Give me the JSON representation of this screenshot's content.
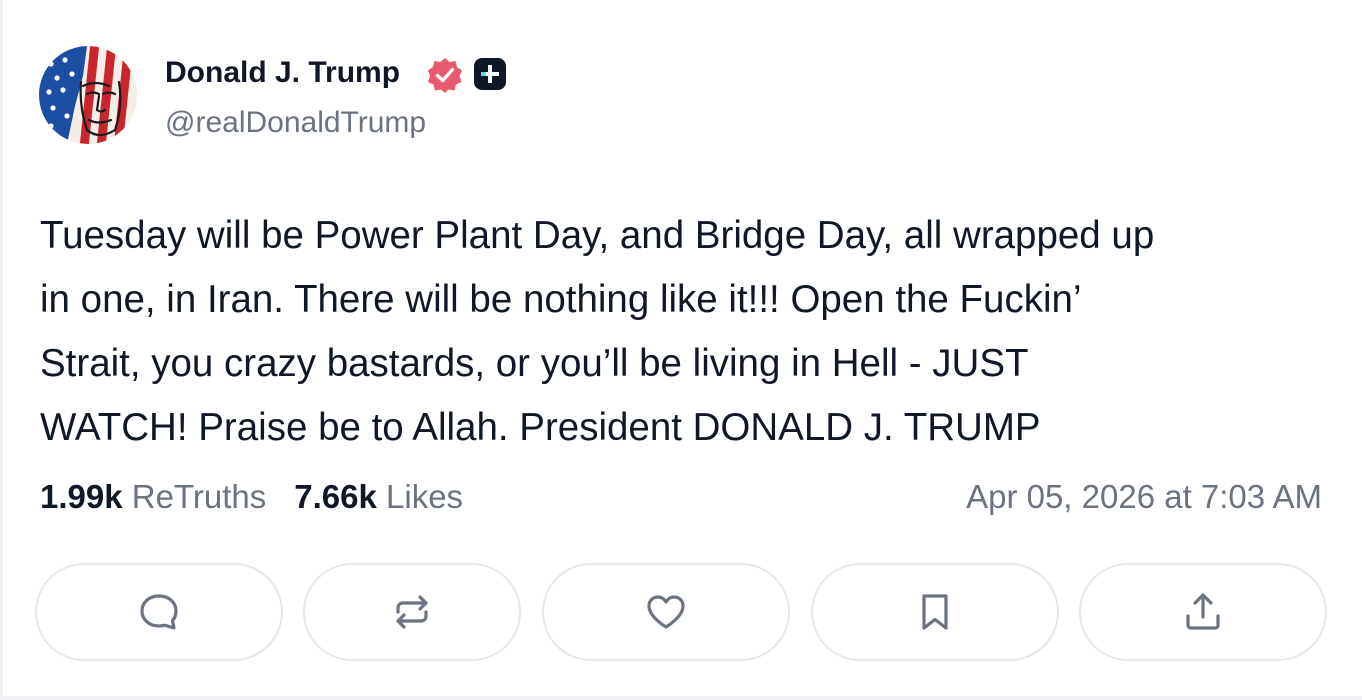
{
  "post": {
    "author": {
      "display_name": "Donald J. Trump",
      "handle": "@realDonaldTrump",
      "avatar_icon": "flag-portrait-avatar",
      "verified_icon": "verified-badge-icon",
      "verified_color": "#ea5a6e",
      "plus_icon": "plus-badge-icon"
    },
    "body_lines": [
      "Tuesday will be Power Plant Day, and Bridge Day, all wrapped up",
      "in one, in Iran. There will be nothing like it!!! Open the Fuckin’",
      "Strait, you crazy bastards, or you’ll be living in Hell - JUST",
      "WATCH! Praise be to Allah. President DONALD J. TRUMP"
    ],
    "stats": {
      "retruths_count": "1.99k",
      "retruths_label": "ReTruths",
      "likes_count": "7.66k",
      "likes_label": "Likes"
    },
    "timestamp": "Apr 05, 2026 at 7:03 AM",
    "actions": [
      {
        "name": "reply",
        "icon": "comment-icon"
      },
      {
        "name": "retruth",
        "icon": "repost-icon"
      },
      {
        "name": "like",
        "icon": "heart-icon"
      },
      {
        "name": "bookmark",
        "icon": "bookmark-icon"
      },
      {
        "name": "share",
        "icon": "share-icon"
      }
    ]
  },
  "colors": {
    "text": "#101828",
    "muted": "#6b7280",
    "border": "#e5e7eb",
    "icon": "#6b7280"
  }
}
